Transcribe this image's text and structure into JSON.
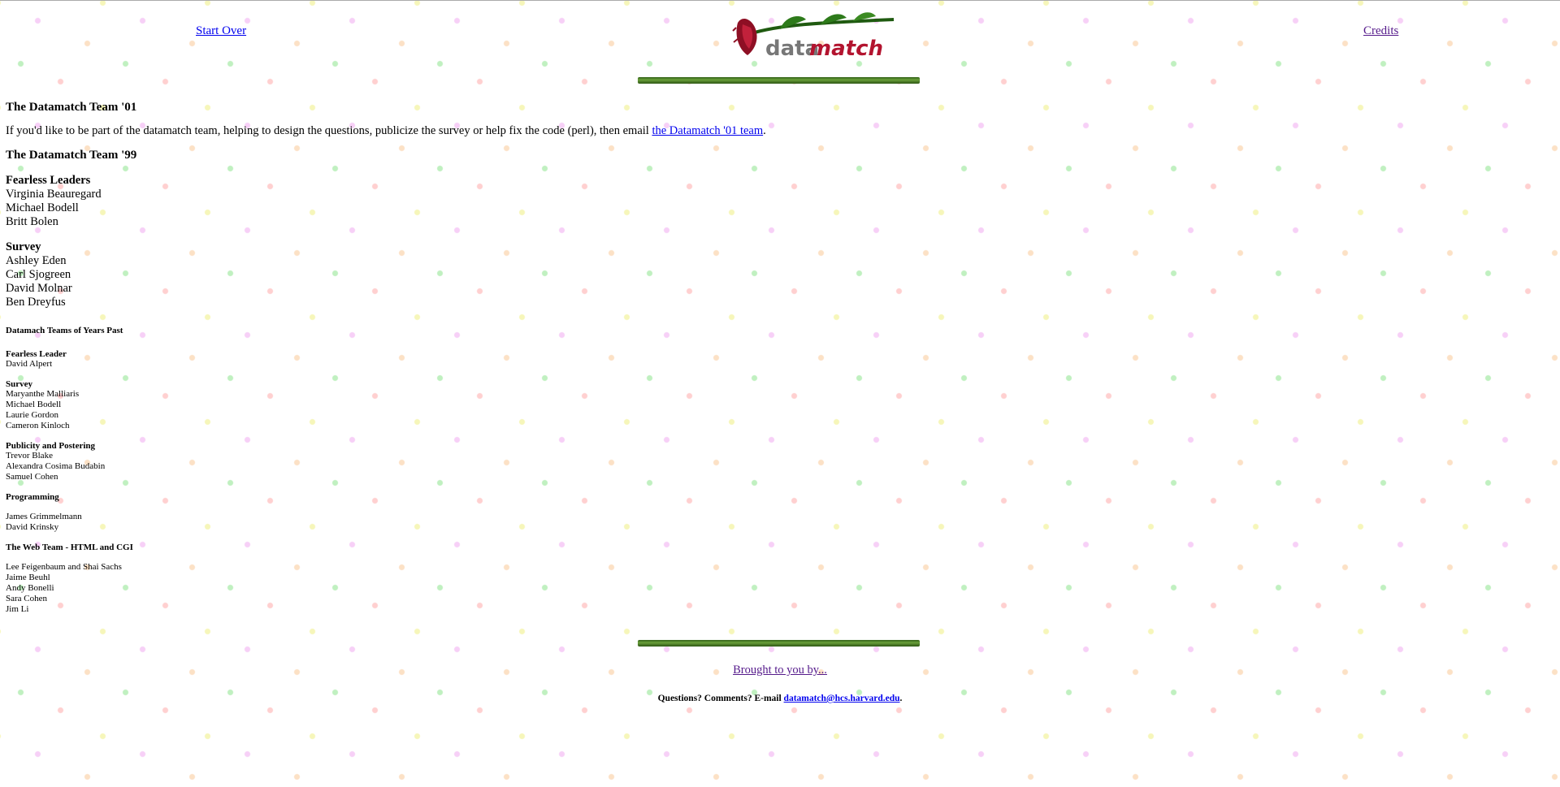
{
  "nav": {
    "start_over": "Start Over",
    "credits": "Credits"
  },
  "logo": {
    "text_prefix": "data",
    "text_suffix": "match"
  },
  "team01": {
    "title": "The Datamatch Team '01",
    "para_before": "If you'd like to be part of the datamatch team, helping to design the questions, publicize the survey or help fix the code (perl), then email ",
    "para_link": "the Datamatch '01 team",
    "para_after": "."
  },
  "team99": {
    "title": "The Datamatch Team '99",
    "groups": [
      {
        "title": "Fearless Leaders",
        "members": [
          "Virginia Beauregard",
          "Michael Bodell",
          "Britt Bolen"
        ]
      },
      {
        "title": "Survey",
        "members": [
          "Ashley Eden",
          "Carl Sjogreen",
          "David Molnar",
          "Ben Dreyfus"
        ]
      }
    ]
  },
  "past": {
    "title": "Datamach Teams of Years Past",
    "groups": [
      {
        "title": "Fearless Leader",
        "members": [
          "David Alpert"
        ]
      },
      {
        "title": "Survey",
        "members": [
          "Maryanthe Malliaris",
          "Michael Bodell",
          "Laurie Gordon",
          "Cameron Kinloch"
        ]
      },
      {
        "title": "Publicity and Postering",
        "members": [
          "Trevor Blake",
          "Alexandra Cosima Budabin",
          "Samuel Cohen"
        ]
      },
      {
        "title": "Programming",
        "members": [
          "James Grimmelmann",
          "David Krinsky"
        ]
      },
      {
        "title": "The Web Team - HTML and CGI",
        "members": [
          "Lee Feigenbaum and Shai Sachs",
          "Jaime Beuhl",
          "Andy Bonelli",
          "Sara Cohen",
          "Jim Li"
        ]
      }
    ]
  },
  "footer": {
    "brought_by": "Brought to you by...",
    "contact_prefix": "Questions? Comments? E-mail ",
    "contact_email": "datamatch@hcs.harvard.edu",
    "contact_suffix": "."
  }
}
